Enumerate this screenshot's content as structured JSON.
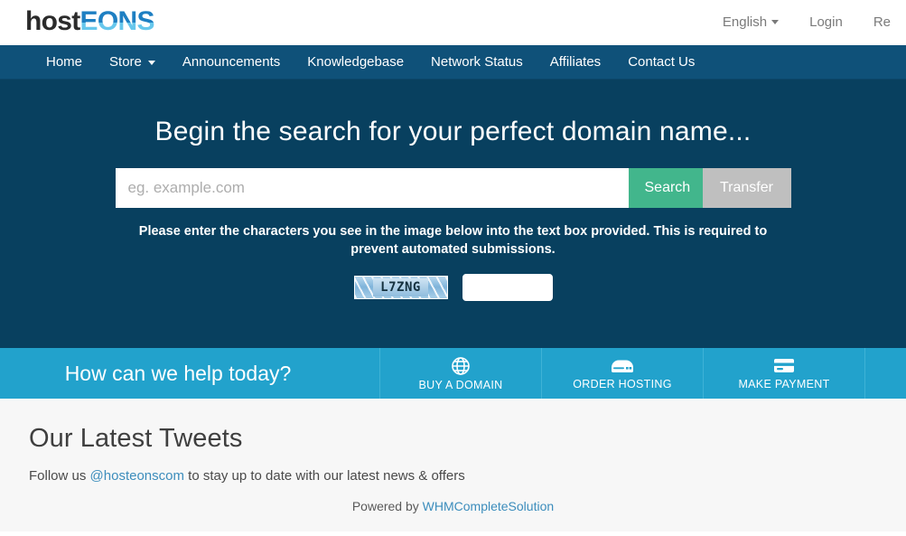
{
  "brand": {
    "logo_part1": "host",
    "logo_part2": "EONS"
  },
  "topnav": {
    "language": "English",
    "login": "Login",
    "register": "Re"
  },
  "mainnav": {
    "items": [
      {
        "label": "Home",
        "caret": false
      },
      {
        "label": "Store",
        "caret": true
      },
      {
        "label": "Announcements",
        "caret": false
      },
      {
        "label": "Knowledgebase",
        "caret": false
      },
      {
        "label": "Network Status",
        "caret": false
      },
      {
        "label": "Affiliates",
        "caret": false
      },
      {
        "label": "Contact Us",
        "caret": false
      }
    ]
  },
  "hero": {
    "heading": "Begin the search for your perfect domain name...",
    "search_placeholder": "eg. example.com",
    "search_value": "",
    "search_button": "Search",
    "transfer_button": "Transfer",
    "captcha_note": "Please enter the characters you see in the image below into the text box provided. This is required to prevent automated submissions.",
    "captcha_text": "L7ZNG",
    "captcha_input_value": "",
    "captcha_input_placeholder": ""
  },
  "helpbar": {
    "title": "How can we help today?",
    "actions": [
      {
        "label": "BUY A DOMAIN",
        "icon": "globe-icon"
      },
      {
        "label": "ORDER HOSTING",
        "icon": "server-icon"
      },
      {
        "label": "MAKE PAYMENT",
        "icon": "credit-card-icon"
      }
    ]
  },
  "main": {
    "tweets_heading": "Our Latest Tweets",
    "follow_prefix": "Follow us ",
    "follow_handle": "@hosteonscom",
    "follow_suffix": " to stay up to date with our latest news & offers"
  },
  "footer": {
    "powered_prefix": "Powered by ",
    "powered_link": "WHMCompleteSolution"
  },
  "colors": {
    "hero_bg": "#08405f",
    "nav_bg": "#0f5179",
    "help_bg": "#22a2cc",
    "search_btn": "#42b68c",
    "transfer_btn": "#bfbfbf",
    "link": "#3c8dbc"
  }
}
